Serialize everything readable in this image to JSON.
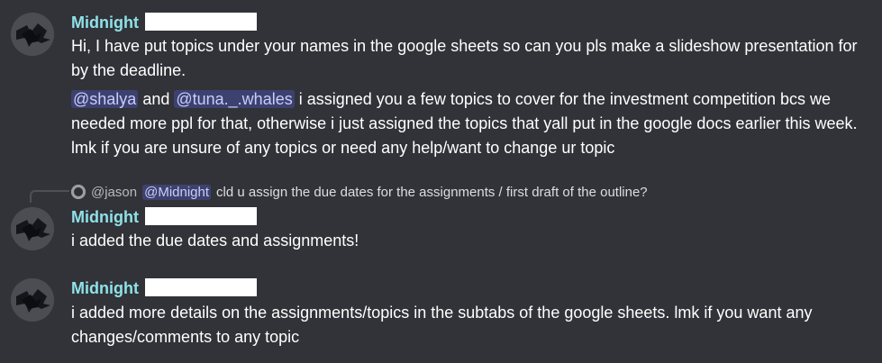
{
  "colors": {
    "background": "#313338",
    "username": "#8fe1e8",
    "mention_bg": "#4a4f8a",
    "mention_text": "#c9cdfb",
    "text": "#ffffff"
  },
  "messages": [
    {
      "author": "Midnight",
      "paragraphs": [
        {
          "text": "Hi, I have put topics under your names in the google sheets so can you pls make a slideshow presentation for by the deadline."
        },
        {
          "mention1": "@shalya",
          "between": " and ",
          "mention2": "@tuna._.whales",
          "text": " i assigned you a few topics to cover for the investment competition bcs we needed more ppl for that, otherwise i just assigned the topics that yall put in the google docs earlier this week. lmk if you are unsure of any topics or need any help/want to change ur topic"
        }
      ]
    },
    {
      "reply": {
        "author": "@jason",
        "mention": "@Midnight",
        "text": "cld u assign the due dates for the assignments / first draft of the outline?"
      },
      "author": "Midnight",
      "text": "i added the due dates and assignments!"
    },
    {
      "author": "Midnight",
      "text": "i added more details on the assignments/topics in the subtabs of the google sheets. lmk if you want any changes/comments to any topic"
    }
  ]
}
